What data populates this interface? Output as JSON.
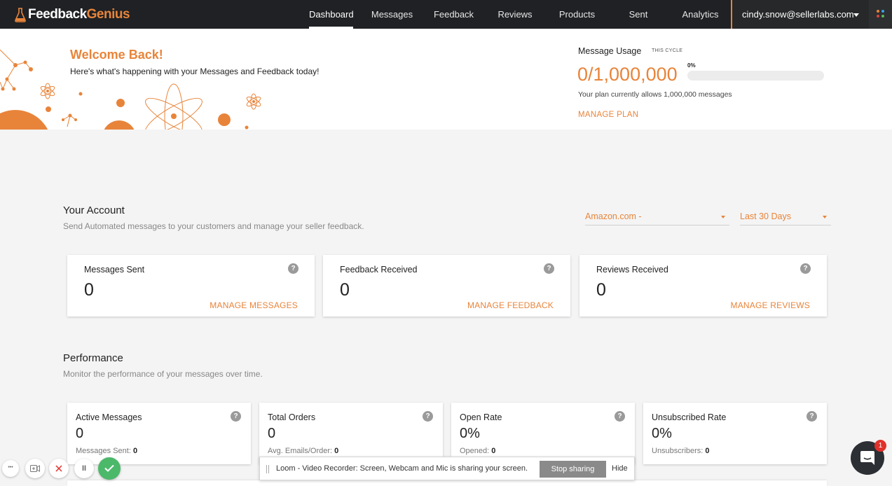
{
  "brand": {
    "part1": "Feedback",
    "part2": "Genius"
  },
  "nav": {
    "items": [
      {
        "label": "Dashboard",
        "active": true
      },
      {
        "label": "Messages"
      },
      {
        "label": "Feedback"
      },
      {
        "label": "Reviews"
      },
      {
        "label": "Products"
      },
      {
        "label": "Sent"
      },
      {
        "label": "Analytics"
      }
    ],
    "user_email": "cindy.snow@sellerlabs.com"
  },
  "hero": {
    "title": "Welcome Back!",
    "subtitle": "Here's what's happening with your Messages and Feedback today!"
  },
  "usage": {
    "title": "Message Usage",
    "cycle": "THIS CYCLE",
    "count": "0/1,000,000",
    "percent_label": "0%",
    "percent": 0,
    "note": "Your plan currently allows 1,000,000 messages",
    "manage": "MANAGE PLAN"
  },
  "account": {
    "title": "Your Account",
    "subtitle": "Send Automated messages to your customers and manage your seller feedback.",
    "marketplace": "Amazon.com -",
    "range": "Last 30 Days",
    "cards": [
      {
        "label": "Messages Sent",
        "value": "0",
        "link": "MANAGE MESSAGES"
      },
      {
        "label": "Feedback Received",
        "value": "0",
        "link": "MANAGE FEEDBACK"
      },
      {
        "label": "Reviews Received",
        "value": "0",
        "link": "MANAGE REVIEWS"
      }
    ]
  },
  "performance": {
    "title": "Performance",
    "subtitle": "Monitor the performance of your messages over time.",
    "cards": [
      {
        "label": "Active Messages",
        "value": "0",
        "sub_label": "Messages Sent:",
        "sub_value": "0"
      },
      {
        "label": "Total Orders",
        "value": "0",
        "sub_label": "Avg. Emails/Order:",
        "sub_value": "0"
      },
      {
        "label": "Open Rate",
        "value": "0%",
        "sub_label": "Opened:",
        "sub_value": "0"
      },
      {
        "label": "Unsubscribed Rate",
        "value": "0%",
        "sub_label": "Unsubscribers:",
        "sub_value": "0"
      }
    ]
  },
  "help_glyph": "?",
  "loom": {
    "message": "Loom - Video Recorder: Screen, Webcam and Mic is sharing your screen.",
    "stop": "Stop sharing",
    "hide": "Hide"
  },
  "recorder": {
    "more": "•••",
    "pause": "II"
  },
  "chat": {
    "badge": "1"
  },
  "colors": {
    "accent": "#e8843a",
    "nav_bg": "#1f2124",
    "page_bg": "#f4f4f4"
  }
}
